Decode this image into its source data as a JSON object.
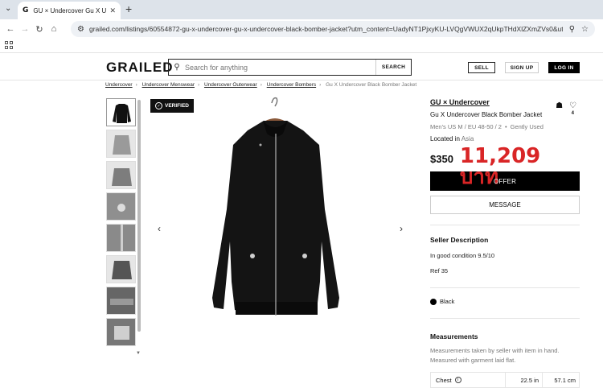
{
  "browser": {
    "tab_title": "GU × Undercover Gu X Undercc",
    "tab_favicon": "G",
    "url": "grailed.com/listings/60554872-gu-x-undercover-gu-x-undercover-black-bomber-jacket?utm_content=UadyNT1PjxyKU-LVQgVWUX2qUkpTHdXlZXmZVs0&utm_source=i..."
  },
  "header": {
    "logo": "GRAILED",
    "search_placeholder": "Search for anything",
    "search_button": "SEARCH",
    "sell": "SELL",
    "sign_up": "SIGN UP",
    "log_in": "LOG IN"
  },
  "breadcrumb": {
    "items": [
      "Undercover",
      "Undercover Menswear",
      "Undercover Outerwear",
      "Undercover Bombers"
    ],
    "current": "Gu X Undercover Black Bomber Jacket"
  },
  "badge": {
    "verified": "VERIFIED"
  },
  "listing": {
    "brand": "GU × Undercover",
    "title": "Gu X Undercover Black Bomber Jacket",
    "size": "Men's US M / EU 48-50 / 2",
    "condition": "Gently Used",
    "location_label": "Located in",
    "location": "Asia",
    "price": "$350",
    "price_local": "11,209 บาท",
    "likes": "4",
    "offer": "OFFER",
    "message": "MESSAGE"
  },
  "description": {
    "title": "Seller Description",
    "lines": [
      "In good condition 9.5/10",
      "Ref 35"
    ]
  },
  "color": {
    "name": "Black",
    "swatch": "#000000"
  },
  "measurements": {
    "title": "Measurements",
    "note": "Measurements taken by seller with item in hand. Measured with garment laid flat.",
    "rows": [
      {
        "label": "Chest",
        "in": "22.5 in",
        "cm": "57.1 cm"
      }
    ]
  },
  "colors": {
    "accent_red": "#d92526"
  }
}
